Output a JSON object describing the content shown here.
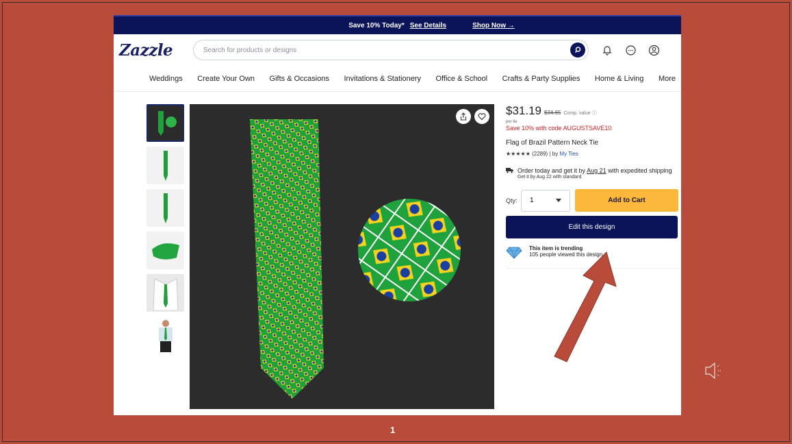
{
  "promo": {
    "save_text": "Save 10% Today*",
    "details_link": "See Details",
    "shop_link": "Shop Now →"
  },
  "header": {
    "logo": "Zazzle",
    "search_placeholder": "Search for products or designs"
  },
  "nav": [
    "Weddings",
    "Create Your Own",
    "Gifts & Occasions",
    "Invitations & Stationery",
    "Office & School",
    "Crafts & Party Supplies",
    "Home & Living",
    "More"
  ],
  "product": {
    "price": "$31.19",
    "old_price": "$34.65",
    "comp_label": "Comp. value ⓘ",
    "per_unit": "per tie",
    "save_text": "Save 10% with code AUGUSTSAVE10",
    "name": "Flag of Brazil Pattern Neck Tie",
    "rating_stars": "★★★★★",
    "rating_count": "(2289) | by",
    "maker": "My Ties",
    "delivery_prefix": "Order today and get it by",
    "delivery_date": "Aug 21",
    "delivery_suffix": "with expedited shipping",
    "delivery_standard": "Get it by Aug 22 with standard",
    "qty_label": "Qty:",
    "qty_value": "1",
    "add_to_cart": "Add to Cart",
    "edit_design": "Edit this design",
    "trend_title": "This item is trending",
    "trend_sub": "105 people viewed this design"
  },
  "slide_number": "1",
  "colors": {
    "navy": "#0b1459",
    "cta": "#fbb73a",
    "slide_bg": "#b84b3a",
    "arrow": "#b84b3a"
  }
}
